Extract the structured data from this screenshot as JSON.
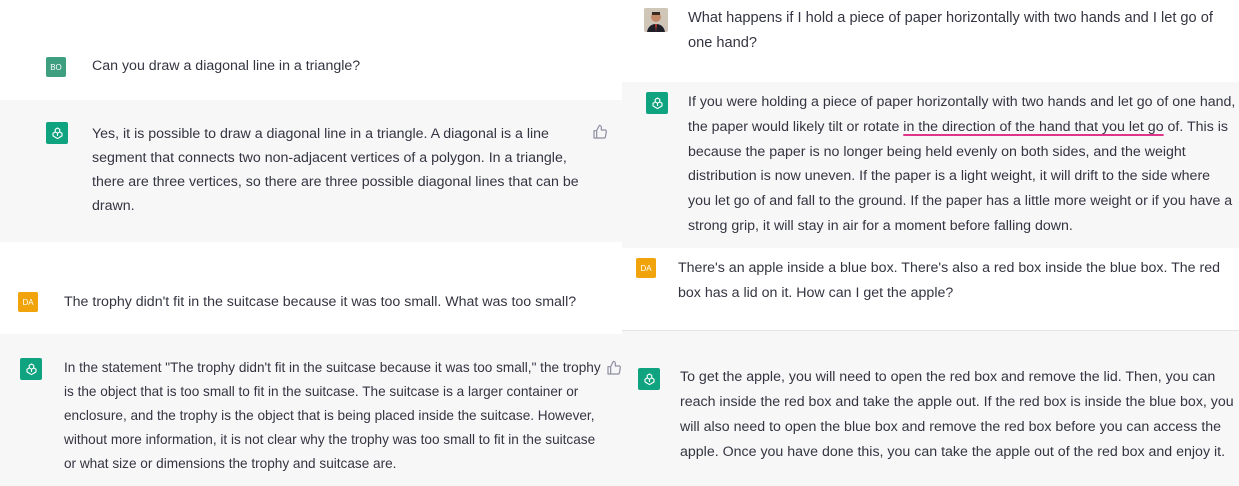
{
  "left_panel": {
    "q1": {
      "avatar": "BO",
      "text": "Can you draw a diagonal line in a triangle?"
    },
    "a1": {
      "text": "Yes, it is possible to draw a diagonal line in a triangle. A diagonal is a line segment that connects two non-adjacent vertices of a polygon. In a triangle, there are three vertices, so there are three possible diagonal lines that can be drawn."
    },
    "q2": {
      "avatar": "DA",
      "text": "The trophy didn't fit in the suitcase because it was too small. What was too small?"
    },
    "a2": {
      "text": "In the statement \"The trophy didn't fit in the suitcase because it was too small,\" the trophy is the object that is too small to fit in the suitcase. The suitcase is a larger container or enclosure, and the trophy is the object that is being placed inside the suitcase. However, without more information, it is not clear why the trophy was too small to fit in the suitcase or what size or dimensions the trophy and suitcase are."
    }
  },
  "right_panel": {
    "q1": {
      "text": "What happens if I hold a piece of paper horizontally with two hands and I let go of one hand?"
    },
    "a1": {
      "text_before": "If you were holding a piece of paper horizontally with two hands and let go of one hand, the paper would likely tilt or rotate ",
      "text_underlined": "in the direction of the hand that you let go",
      "text_after": " of. This is because the paper is no longer being held evenly on both sides, and the weight distribution is now uneven. If the paper is a light weight, it will drift to the side where you let go of and fall to the ground. If the paper has a little more weight or if you have a strong grip, it will stay in air for a moment before falling down."
    },
    "q2": {
      "avatar": "DA",
      "text": "There's an apple inside a blue box. There's also a red box inside the blue box. The red box has a lid on it. How can I get the apple?"
    },
    "a2": {
      "text": "To get the apple, you will need to open the red box and remove the lid. Then, you can reach inside the red box and take the apple out. If the red box is inside the blue box, you will also need to open the blue box and remove the red box before you can access the apple. Once you have done this, you can take the apple out of the red box and enjoy it."
    }
  },
  "icons": {
    "assistant": "openai-logo-icon",
    "feedback": "thumbs-up-icon"
  },
  "colors": {
    "assistant_bg": "#f7f7f8",
    "gpt_green": "#10a37f",
    "da_orange": "#f0a30a",
    "bo_green": "#3d9e80",
    "underline": "#e0348a"
  }
}
